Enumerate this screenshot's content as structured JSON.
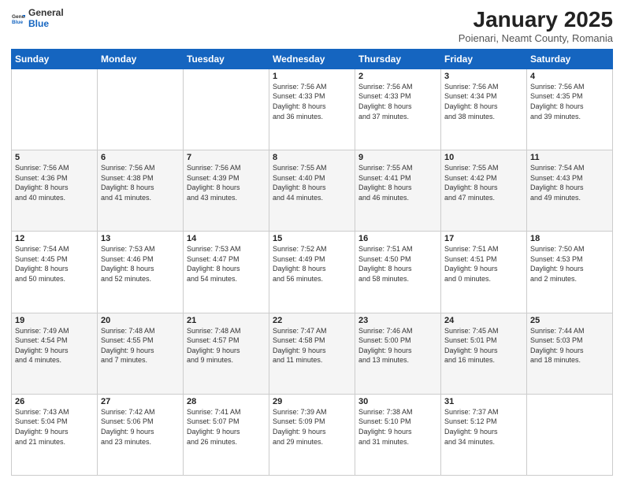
{
  "logo": {
    "general": "General",
    "blue": "Blue"
  },
  "header": {
    "month": "January 2025",
    "location": "Poienari, Neamt County, Romania"
  },
  "days_of_week": [
    "Sunday",
    "Monday",
    "Tuesday",
    "Wednesday",
    "Thursday",
    "Friday",
    "Saturday"
  ],
  "weeks": [
    [
      {
        "day": "",
        "info": ""
      },
      {
        "day": "",
        "info": ""
      },
      {
        "day": "",
        "info": ""
      },
      {
        "day": "1",
        "info": "Sunrise: 7:56 AM\nSunset: 4:33 PM\nDaylight: 8 hours\nand 36 minutes."
      },
      {
        "day": "2",
        "info": "Sunrise: 7:56 AM\nSunset: 4:33 PM\nDaylight: 8 hours\nand 37 minutes."
      },
      {
        "day": "3",
        "info": "Sunrise: 7:56 AM\nSunset: 4:34 PM\nDaylight: 8 hours\nand 38 minutes."
      },
      {
        "day": "4",
        "info": "Sunrise: 7:56 AM\nSunset: 4:35 PM\nDaylight: 8 hours\nand 39 minutes."
      }
    ],
    [
      {
        "day": "5",
        "info": "Sunrise: 7:56 AM\nSunset: 4:36 PM\nDaylight: 8 hours\nand 40 minutes."
      },
      {
        "day": "6",
        "info": "Sunrise: 7:56 AM\nSunset: 4:38 PM\nDaylight: 8 hours\nand 41 minutes."
      },
      {
        "day": "7",
        "info": "Sunrise: 7:56 AM\nSunset: 4:39 PM\nDaylight: 8 hours\nand 43 minutes."
      },
      {
        "day": "8",
        "info": "Sunrise: 7:55 AM\nSunset: 4:40 PM\nDaylight: 8 hours\nand 44 minutes."
      },
      {
        "day": "9",
        "info": "Sunrise: 7:55 AM\nSunset: 4:41 PM\nDaylight: 8 hours\nand 46 minutes."
      },
      {
        "day": "10",
        "info": "Sunrise: 7:55 AM\nSunset: 4:42 PM\nDaylight: 8 hours\nand 47 minutes."
      },
      {
        "day": "11",
        "info": "Sunrise: 7:54 AM\nSunset: 4:43 PM\nDaylight: 8 hours\nand 49 minutes."
      }
    ],
    [
      {
        "day": "12",
        "info": "Sunrise: 7:54 AM\nSunset: 4:45 PM\nDaylight: 8 hours\nand 50 minutes."
      },
      {
        "day": "13",
        "info": "Sunrise: 7:53 AM\nSunset: 4:46 PM\nDaylight: 8 hours\nand 52 minutes."
      },
      {
        "day": "14",
        "info": "Sunrise: 7:53 AM\nSunset: 4:47 PM\nDaylight: 8 hours\nand 54 minutes."
      },
      {
        "day": "15",
        "info": "Sunrise: 7:52 AM\nSunset: 4:49 PM\nDaylight: 8 hours\nand 56 minutes."
      },
      {
        "day": "16",
        "info": "Sunrise: 7:51 AM\nSunset: 4:50 PM\nDaylight: 8 hours\nand 58 minutes."
      },
      {
        "day": "17",
        "info": "Sunrise: 7:51 AM\nSunset: 4:51 PM\nDaylight: 9 hours\nand 0 minutes."
      },
      {
        "day": "18",
        "info": "Sunrise: 7:50 AM\nSunset: 4:53 PM\nDaylight: 9 hours\nand 2 minutes."
      }
    ],
    [
      {
        "day": "19",
        "info": "Sunrise: 7:49 AM\nSunset: 4:54 PM\nDaylight: 9 hours\nand 4 minutes."
      },
      {
        "day": "20",
        "info": "Sunrise: 7:48 AM\nSunset: 4:55 PM\nDaylight: 9 hours\nand 7 minutes."
      },
      {
        "day": "21",
        "info": "Sunrise: 7:48 AM\nSunset: 4:57 PM\nDaylight: 9 hours\nand 9 minutes."
      },
      {
        "day": "22",
        "info": "Sunrise: 7:47 AM\nSunset: 4:58 PM\nDaylight: 9 hours\nand 11 minutes."
      },
      {
        "day": "23",
        "info": "Sunrise: 7:46 AM\nSunset: 5:00 PM\nDaylight: 9 hours\nand 13 minutes."
      },
      {
        "day": "24",
        "info": "Sunrise: 7:45 AM\nSunset: 5:01 PM\nDaylight: 9 hours\nand 16 minutes."
      },
      {
        "day": "25",
        "info": "Sunrise: 7:44 AM\nSunset: 5:03 PM\nDaylight: 9 hours\nand 18 minutes."
      }
    ],
    [
      {
        "day": "26",
        "info": "Sunrise: 7:43 AM\nSunset: 5:04 PM\nDaylight: 9 hours\nand 21 minutes."
      },
      {
        "day": "27",
        "info": "Sunrise: 7:42 AM\nSunset: 5:06 PM\nDaylight: 9 hours\nand 23 minutes."
      },
      {
        "day": "28",
        "info": "Sunrise: 7:41 AM\nSunset: 5:07 PM\nDaylight: 9 hours\nand 26 minutes."
      },
      {
        "day": "29",
        "info": "Sunrise: 7:39 AM\nSunset: 5:09 PM\nDaylight: 9 hours\nand 29 minutes."
      },
      {
        "day": "30",
        "info": "Sunrise: 7:38 AM\nSunset: 5:10 PM\nDaylight: 9 hours\nand 31 minutes."
      },
      {
        "day": "31",
        "info": "Sunrise: 7:37 AM\nSunset: 5:12 PM\nDaylight: 9 hours\nand 34 minutes."
      },
      {
        "day": "",
        "info": ""
      }
    ]
  ]
}
